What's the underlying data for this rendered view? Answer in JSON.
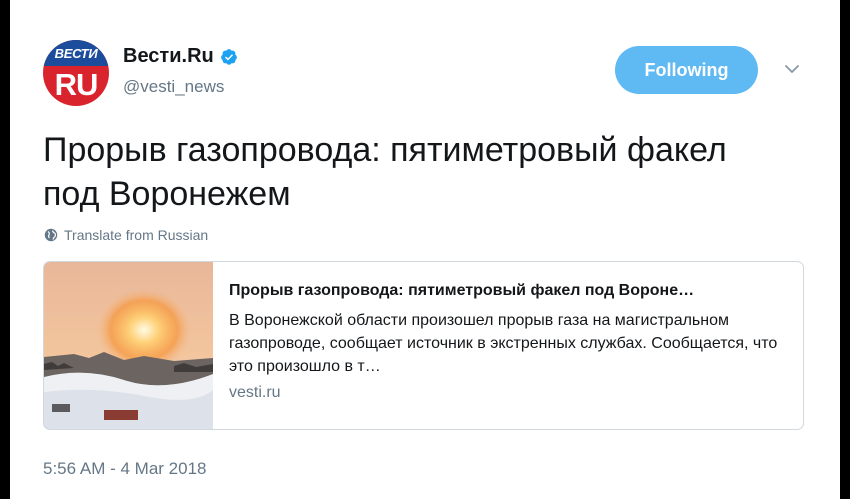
{
  "user": {
    "name": "Вести.Ru",
    "handle": "@vesti_news",
    "avatar_top": "ВЕСТИ",
    "avatar_bottom": "RU"
  },
  "follow_button": {
    "label": "Following"
  },
  "tweet": {
    "text": "Прорыв газопровода: пятиметровый факел под Воронежем",
    "translate_label": "Translate from Russian",
    "timestamp": "5:56 AM - 4 Mar 2018"
  },
  "card": {
    "title": "Прорыв газопровода: пятиметровый факел под Вороне…",
    "description": "В Воронежской области произошел прорыв газа на магистральном газопроводе, сообщает источник в экстренных службах. Сообщается, что это произошло в т…",
    "domain": "vesti.ru"
  },
  "icons": {
    "verified": "verified-badge-icon",
    "caret": "chevron-down-icon",
    "globe": "globe-icon"
  },
  "colors": {
    "follow_button": "#5fb9f3",
    "verified": "#1da1f2",
    "avatar_red": "#d9232d",
    "avatar_blue": "#1c4d9c",
    "secondary_text": "#657786"
  }
}
